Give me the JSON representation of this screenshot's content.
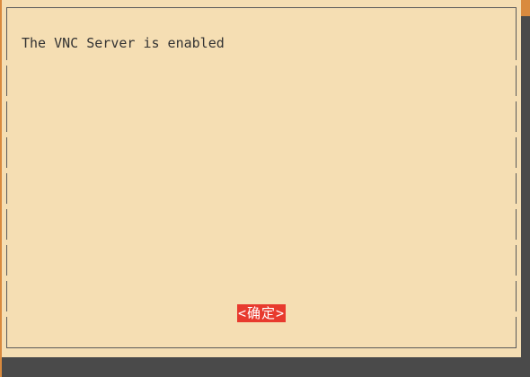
{
  "dialog": {
    "message": "The VNC Server is enabled",
    "ok_button_label": "<确定>"
  },
  "colors": {
    "dialog_background": "#f5deb3",
    "screen_background": "#4a4a4a",
    "frame_border": "#5a5a5a",
    "button_background": "#e83a2e",
    "button_text": "#ffffff",
    "accent_strip": "#d98a3e"
  }
}
